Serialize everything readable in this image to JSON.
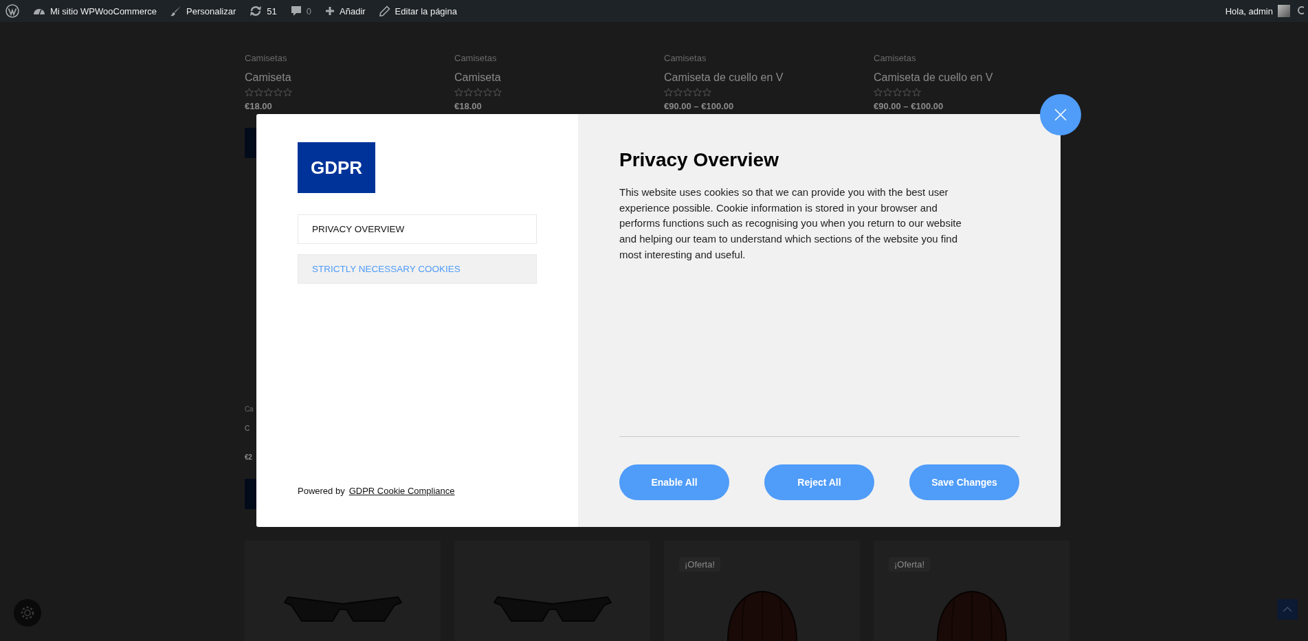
{
  "admin_bar": {
    "items": [
      {
        "kind": "wp-logo"
      },
      {
        "kind": "site",
        "label": "Mi sitio WPWooCommerce"
      },
      {
        "kind": "customize",
        "label": "Personalizar"
      },
      {
        "kind": "updates",
        "label": "51"
      },
      {
        "kind": "comments",
        "label": "0"
      },
      {
        "kind": "new",
        "label": "Añadir"
      },
      {
        "kind": "edit",
        "label": "Editar la página"
      }
    ],
    "greeting": "Hola, admin"
  },
  "products_top": [
    {
      "category": "Camisetas",
      "title": "Camiseta",
      "stars": 0,
      "price": "€18.00",
      "has_button": true
    },
    {
      "category": "Camisetas",
      "title": "Camiseta",
      "stars": 0,
      "price": "€18.00"
    },
    {
      "category": "Camisetas",
      "title": "Camiseta de cuello en V",
      "stars": 0,
      "price": "€90.00 – €100.00"
    },
    {
      "category": "Camisetas",
      "title": "Camiseta de cuello en V",
      "stars": 0,
      "price": "€90.00 – €100.00"
    }
  ],
  "products_middle": [
    {
      "category": "Ca",
      "title": "C",
      "price": "€2",
      "has_button": true
    }
  ],
  "products_bottom": [
    {
      "kind": "sunglasses"
    },
    {
      "kind": "sunglasses"
    },
    {
      "kind": "cap",
      "badge": "¡Oferta!"
    },
    {
      "kind": "cap",
      "badge": "¡Oferta!"
    }
  ],
  "modal": {
    "logo": "GDPR",
    "tabs": [
      {
        "label": "PRIVACY OVERVIEW",
        "selected": true
      },
      {
        "label": "STRICTLY NECESSARY COOKIES",
        "selected": false
      }
    ],
    "powered_by": "Powered by",
    "powered_link": "GDPR Cookie Compliance",
    "title": "Privacy Overview",
    "text": "This website uses cookies so that we can provide you with the best user experience possible. Cookie information is stored in your browser and performs functions such as recognising you when you return to our website and helping our team to understand which sections of the website you find most interesting and useful.",
    "buttons": [
      "Enable All",
      "Reject All",
      "Save Changes"
    ]
  }
}
